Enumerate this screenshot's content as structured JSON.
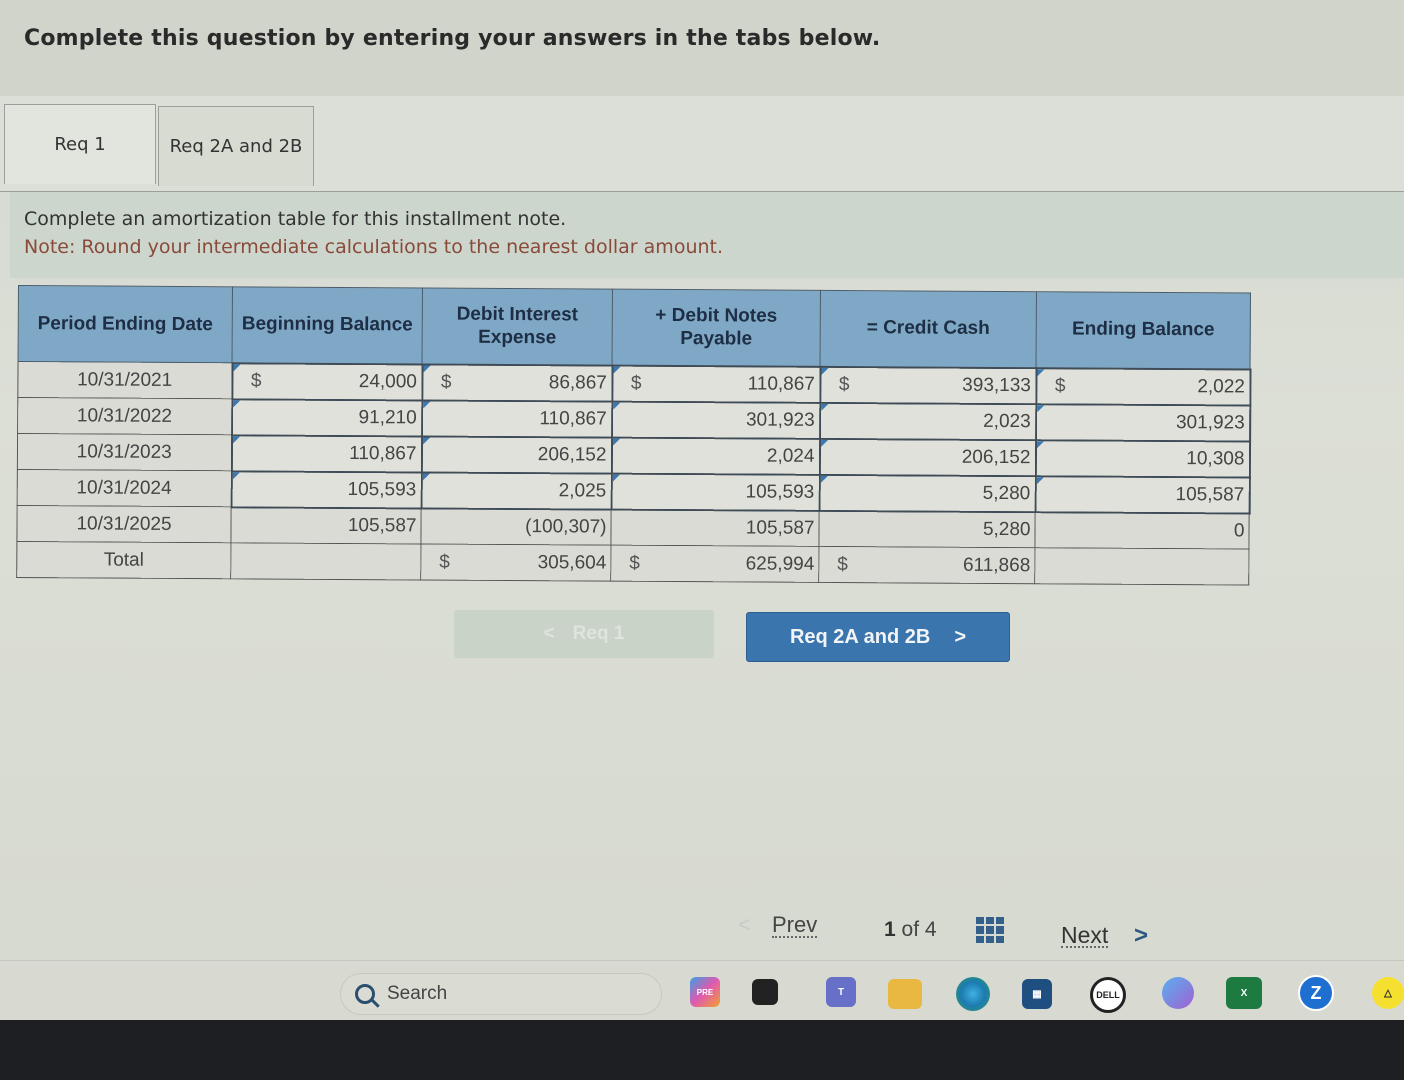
{
  "instruction": "Complete this question by entering your answers in the tabs below.",
  "tabs": [
    {
      "label": "Req 1",
      "active": true
    },
    {
      "label": "Req 2A and 2B",
      "active": false
    }
  ],
  "prompt": {
    "line1": "Complete an amortization table for this installment note.",
    "line2": "Note: Round your intermediate calculations to the nearest dollar amount."
  },
  "table": {
    "headers": [
      "Period Ending Date",
      "Beginning Balance",
      "Debit Interest Expense",
      "+ Debit Notes Payable",
      "= Credit Cash",
      "Ending Balance"
    ],
    "currency_symbol": "$",
    "rows": [
      {
        "date": "10/31/2021",
        "beginning": "24,000",
        "interest": "86,867",
        "notes": "110,867",
        "cash": "393,133",
        "ending": "2,022"
      },
      {
        "date": "10/31/2022",
        "beginning": "91,210",
        "interest": "110,867",
        "notes": "301,923",
        "cash": "2,023",
        "ending": "301,923"
      },
      {
        "date": "10/31/2023",
        "beginning": "110,867",
        "interest": "206,152",
        "notes": "2,024",
        "cash": "206,152",
        "ending": "10,308"
      },
      {
        "date": "10/31/2024",
        "beginning": "105,593",
        "interest": "2,025",
        "notes": "105,593",
        "cash": "5,280",
        "ending": "105,587"
      },
      {
        "date": "10/31/2025",
        "beginning": "105,587",
        "interest": "(100,307)",
        "notes": "105,587",
        "cash": "5,280",
        "ending": "0"
      }
    ],
    "total": {
      "label": "Total",
      "interest": "305,604",
      "notes": "625,994",
      "cash": "611,868"
    }
  },
  "nav": {
    "prev_label": "Req 1",
    "next_label": "Req 2A and 2B"
  },
  "pager": {
    "prev": "Prev",
    "current": "1",
    "of": "of",
    "total": "4",
    "next": "Next"
  },
  "taskbar": {
    "search_placeholder": "Search",
    "apps": [
      "copilot-pre-icon",
      "terminal-icon",
      "teams-icon",
      "file-explorer-icon",
      "edge-icon",
      "store-icon",
      "dell-icon",
      "copilot-icon",
      "excel-icon",
      "zoom-icon",
      "snapchat-icon"
    ]
  }
}
